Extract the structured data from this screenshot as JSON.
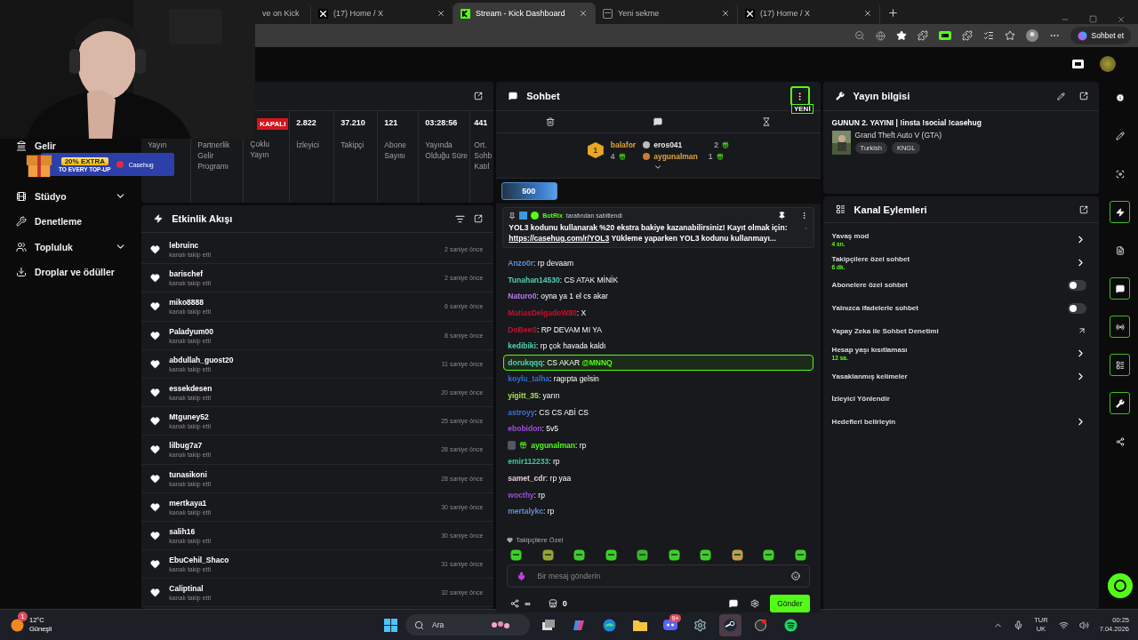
{
  "browser": {
    "tabs": [
      {
        "title": "ve on Kick",
        "kind": "plain",
        "selected": false
      },
      {
        "title": "(17) Home / X",
        "kind": "x",
        "selected": false
      },
      {
        "title": "Stream - Kick Dashboard",
        "kind": "kick",
        "selected": true
      },
      {
        "title": "Yeni sekme",
        "kind": "newtab",
        "selected": false
      },
      {
        "title": "(17) Home / X",
        "kind": "x",
        "selected": false
      }
    ],
    "copilot_button": "Sohbet et"
  },
  "ad": {
    "headline": "20% EXTRA",
    "subline": "TO EVERY TOP-UP",
    "brand": "Casehug"
  },
  "sidebar": {
    "items": [
      {
        "label": "Gelir",
        "kind": "revenue",
        "submenu": false
      },
      {
        "label": "Stüdyo",
        "kind": "studio",
        "submenu": true
      },
      {
        "label": "Denetleme",
        "kind": "moderation",
        "submenu": false
      },
      {
        "label": "Topluluk",
        "kind": "community",
        "submenu": true
      },
      {
        "label": "Droplar ve ödüller",
        "kind": "drops",
        "submenu": false
      }
    ]
  },
  "stats": [
    {
      "label": "Yayın"
    },
    {
      "label": "Partnerlik Gelir Programı"
    },
    {
      "badge": "KAPALI",
      "label": "Çoklu Yayın"
    },
    {
      "value": "2.822",
      "label": "İzleyici"
    },
    {
      "value": "37.210",
      "label": "Takipçi"
    },
    {
      "value": "121",
      "label": "Abone Sayısı"
    },
    {
      "value": "03:28:56",
      "label": "Yayında Olduğu Süre"
    },
    {
      "value": "441",
      "label": "Ort. Sohb Katıl"
    }
  ],
  "activity": {
    "title": "Etkinlik Akışı",
    "events": [
      {
        "user": "lebruinc",
        "action": "kanalı takip etti",
        "time": "2 saniye önce"
      },
      {
        "user": "barischef",
        "action": "kanalı takip etti",
        "time": "2 saniye önce"
      },
      {
        "user": "miko8888",
        "action": "kanalı takip etti",
        "time": "6 saniye önce"
      },
      {
        "user": "Paladyum00",
        "action": "kanalı takip etti",
        "time": "8 saniye önce"
      },
      {
        "user": "abdullah_guost20",
        "action": "kanalı takip etti",
        "time": "11 saniye önce"
      },
      {
        "user": "essekdesen",
        "action": "kanalı takip etti",
        "time": "20 saniye önce"
      },
      {
        "user": "Mtguney52",
        "action": "kanalı takip etti",
        "time": "25 saniye önce"
      },
      {
        "user": "lilbug7a7",
        "action": "kanalı takip etti",
        "time": "28 saniye önce"
      },
      {
        "user": "tunasikoni",
        "action": "kanalı takip etti",
        "time": "28 saniye önce"
      },
      {
        "user": "mertkaya1",
        "action": "kanalı takip etti",
        "time": "30 saniye önce"
      },
      {
        "user": "salih16",
        "action": "kanalı takip etti",
        "time": "30 saniye önce"
      },
      {
        "user": "EbuCehil_Shaco",
        "action": "kanalı takip etti",
        "time": "31 saniye önce"
      },
      {
        "user": "Caliptinal",
        "action": "kanalı takip etti",
        "time": "32 saniye önce"
      }
    ]
  },
  "chat": {
    "title": "Sohbet",
    "new_badge": "YENİ",
    "leaders": [
      {
        "rank": "1",
        "user": "balafor",
        "count": "4",
        "color": "#e0a43a"
      },
      {
        "user": "eros041",
        "count": "2",
        "color": "#e6e6e6"
      },
      {
        "user": "aygunalman",
        "count": "1",
        "color": "#e0a43a"
      }
    ],
    "pill": "500",
    "separator": ":",
    "pinned": {
      "by": "BotRix",
      "note": "tarafından sabitlendi",
      "text": "YOL3 kodunu kullanarak %20 ekstra bakiye kazanabilirsiniz! Kayıt olmak için:",
      "link": "https://casehug.com/r/YOL3",
      "text_after": "Yükleme yaparken YOL3 kodunu kullanmayı..."
    },
    "messages": [
      {
        "user": "Anzo0r",
        "color": "#5b8fd9",
        "text": "rp devaam",
        "kind": "plain"
      },
      {
        "user": "Tunahan14530",
        "color": "#4fd1b5",
        "text": "CS ATAK MİNİK",
        "kind": "plain"
      },
      {
        "user": "Naturo0",
        "color": "#b57bf0",
        "text": "oyna ya 1 el cs akar",
        "kind": "plain"
      },
      {
        "user": "MatiasDelgadoW80",
        "color": "#c8102e",
        "text": "X",
        "kind": "plain"
      },
      {
        "user": "DoBeeS",
        "color": "#c8102e",
        "text": "RP DEVAM MI YA",
        "kind": "plain"
      },
      {
        "user": "kedibiki",
        "color": "#4fd1b5",
        "text": "rp çok havada kaldı",
        "kind": "plain"
      },
      {
        "user": "dorukqqq",
        "color": "#4fd1b5",
        "text": "CS AKAR",
        "mention": "@MNNQ",
        "kind": "mention"
      },
      {
        "user": "koylu_talha",
        "color": "#2f6fd6",
        "text": "ragıpta gelsin",
        "kind": "plain"
      },
      {
        "user": "yigitt_35",
        "color": "#a6e34a",
        "text": "yarın",
        "kind": "plain"
      },
      {
        "user": "astroyy",
        "color": "#3a6fd6",
        "text": "CS CS ABİ CS",
        "kind": "plain"
      },
      {
        "user": "ebobidon",
        "color": "#9b4de0",
        "text": "5v5",
        "kind": "plain"
      },
      {
        "user": "aygunalman",
        "color": "#53fc18",
        "text": "rp",
        "kind": "badged"
      },
      {
        "user": "emir112233",
        "color": "#3cc99a",
        "text": "rp",
        "kind": "plain"
      },
      {
        "user": "samet_cdr",
        "color": "#e8c8d0",
        "text": "rp yaa",
        "kind": "plain"
      },
      {
        "user": "wocthy",
        "color": "#9b4de0",
        "text": "rp",
        "kind": "plain"
      },
      {
        "user": "mertalykc",
        "color": "#5b8fd9",
        "text": "rp",
        "kind": "plain"
      }
    ],
    "emote_label": "Takipçilere Özel",
    "input": {
      "placeholder": "Bir mesaj gönderin"
    },
    "points": "∞",
    "store_count": "0",
    "send_button": "Gönder"
  },
  "stream_info": {
    "title": "Yayın bilgisi",
    "stream_title": "GUNUN 2. YAYINI | !insta !social !casehug",
    "game": "Grand Theft Auto V (GTA)",
    "tags": [
      "Turkish",
      "KNGL"
    ]
  },
  "channel_actions": {
    "title": "Kanal Eylemleri",
    "items": [
      {
        "label": "Yavaş mod",
        "value": "4 sn.",
        "kind": "link"
      },
      {
        "label": "Takipçilere özel sohbet",
        "value": "6 dk.",
        "kind": "link"
      },
      {
        "label": "Abonelere özel sohbet",
        "kind": "toggle",
        "on": false
      },
      {
        "label": "Yalnızca ifadelerle sohbet",
        "kind": "toggle",
        "on": false
      },
      {
        "label": "Yapay Zeka ile Sohbet Denetimi",
        "kind": "external"
      },
      {
        "label": "Hesap yaşı kısıtlaması",
        "value": "12 sa.",
        "kind": "link"
      },
      {
        "label": "Yasaklanmış kelimeler",
        "kind": "link"
      },
      {
        "label": "İzleyici Yönlendir",
        "kind": "plain"
      },
      {
        "label": "Hedefleri belirleyin",
        "kind": "link"
      }
    ]
  },
  "rail": [
    {
      "kind": "info",
      "highlighted": false
    },
    {
      "kind": "edit",
      "highlighted": false
    },
    {
      "kind": "focus",
      "highlighted": false
    },
    {
      "kind": "bolt",
      "highlighted": true
    },
    {
      "kind": "note",
      "highlighted": false
    },
    {
      "kind": "chat",
      "highlighted": true
    },
    {
      "kind": "broadcast",
      "highlighted": true
    },
    {
      "kind": "actions",
      "highlighted": true
    },
    {
      "kind": "tools",
      "highlighted": true
    },
    {
      "kind": "nodes",
      "highlighted": false
    }
  ],
  "taskbar": {
    "weather": {
      "temp": "12°C",
      "condition": "Güneşli",
      "badge": "1"
    },
    "search": {
      "placeholder": "Ara"
    },
    "apps": [
      {
        "kind": "taskview",
        "selected": false
      },
      {
        "kind": "copilot",
        "selected": false
      },
      {
        "kind": "edge",
        "selected": false
      },
      {
        "kind": "folder",
        "selected": false
      },
      {
        "kind": "discord",
        "badge": "9+",
        "selected": false
      },
      {
        "kind": "settings",
        "selected": false
      },
      {
        "kind": "steam",
        "selected": true
      },
      {
        "kind": "recorder",
        "selected": false
      },
      {
        "kind": "spotify",
        "selected": false
      }
    ],
    "lang": "TUR",
    "layout": "UK",
    "time": "00:25",
    "date": "7.04.2026"
  }
}
